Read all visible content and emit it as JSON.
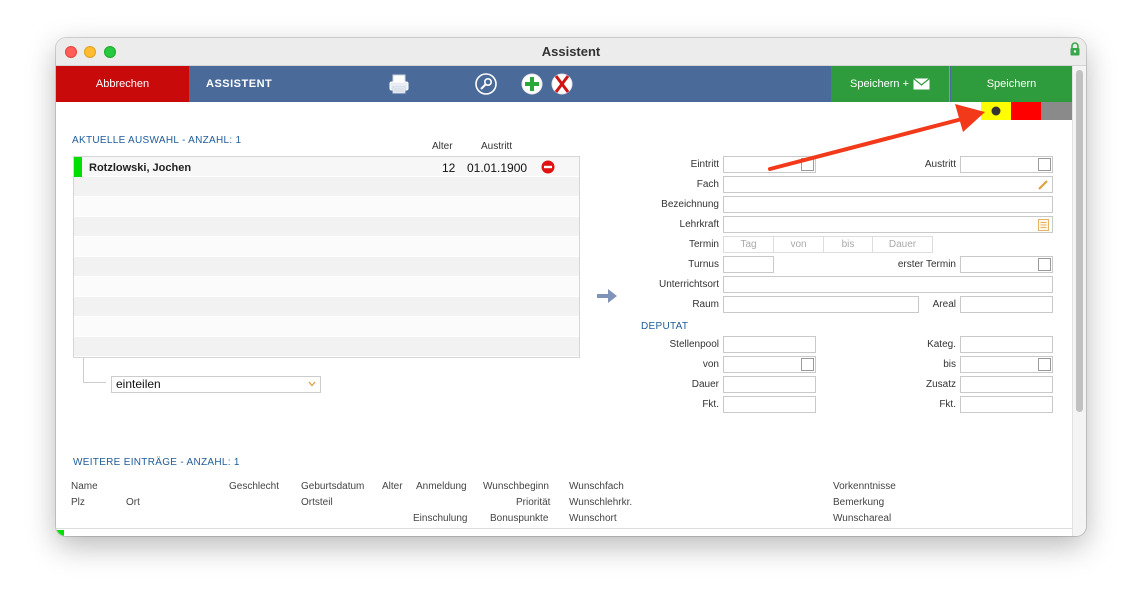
{
  "window": {
    "title": "Assistent"
  },
  "toolbar": {
    "cancel_label": "Abbrechen",
    "title": "ASSISTENT",
    "save_mail_label": "Speichern +",
    "save_label": "Speichern",
    "icons": [
      "printer-icon",
      "wrench-settings-icon",
      "add-icon",
      "delete-icon",
      "mail-icon"
    ]
  },
  "status_colors": {
    "yellow": "#ffff00",
    "red": "#ff0000",
    "gray": "#8a8a8a"
  },
  "selection": {
    "title": "AKTUELLE AUSWAHL - ANZAHL: 1",
    "col_age": "Alter",
    "col_exit": "Austritt",
    "rows": [
      {
        "name": "Rotzlowski, Jochen",
        "age": "12",
        "exit": "01.01.1900",
        "status_color": "#00e000"
      }
    ],
    "dropdown_value": "einteilen"
  },
  "form": {
    "eintritt": "Eintritt",
    "austritt": "Austritt",
    "fach": "Fach",
    "bezeichnung": "Bezeichnung",
    "lehrkraft": "Lehrkraft",
    "termin": "Termin",
    "termin_placeholders": {
      "tag": "Tag",
      "von": "von",
      "bis": "bis",
      "dauer": "Dauer"
    },
    "turnus": "Turnus",
    "erster_termin": "erster Termin",
    "unterrichtsort": "Unterrichtsort",
    "raum": "Raum",
    "areal": "Areal",
    "deputat_title": "DEPUTAT",
    "stellenpool": "Stellenpool",
    "kateg": "Kateg.",
    "von": "von",
    "bis": "bis",
    "dauer": "Dauer",
    "zusatz": "Zusatz",
    "fkt1": "Fkt.",
    "fkt2": "Fkt."
  },
  "more": {
    "title": "WEITERE EINTRÄGE - ANZAHL: 1",
    "headers": {
      "name": "Name",
      "geschlecht": "Geschlecht",
      "geburtsdatum": "Geburtsdatum",
      "alter": "Alter",
      "anmeldung": "Anmeldung",
      "wunschbeginn": "Wunschbeginn",
      "wunschfach": "Wunschfach",
      "vorkenntnisse": "Vorkenntnisse",
      "plz": "Plz",
      "ort": "Ort",
      "ortsteil": "Ortsteil",
      "prioritaet": "Priorität",
      "wunschlehrkr": "Wunschlehrkr.",
      "bemerkung": "Bemerkung",
      "einschulung": "Einschulung",
      "bonuspunkte": "Bonuspunkte",
      "wunschort": "Wunschort",
      "wunschareal": "Wunschareal"
    }
  }
}
